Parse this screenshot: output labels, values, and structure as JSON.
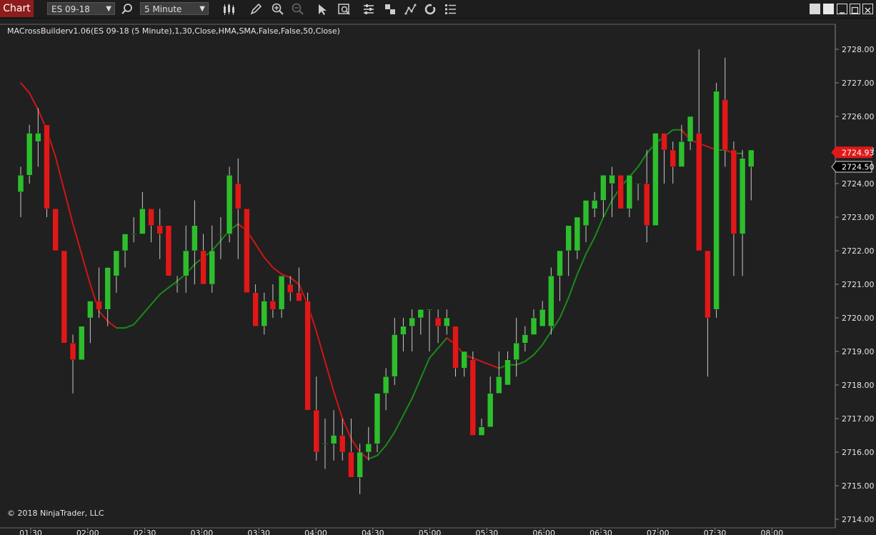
{
  "toolbar": {
    "tab_label": "Chart",
    "instrument": "ES 09-18",
    "interval": "5 Minute",
    "icons": [
      "search-icon",
      "bar-type-icon",
      "draw-icon",
      "zoom-in-icon",
      "zoom-out-icon",
      "pointer-icon",
      "data-box-icon",
      "properties-icon",
      "strategies-icon",
      "indicators-icon",
      "refresh-icon",
      "menu-icon"
    ]
  },
  "chart": {
    "indicator_label": "MACrossBuilderv1.06(ES 09-18 (5 Minute),1,30,Close,HMA,SMA,False,False,50,Close)",
    "copyright": "© 2018 NinjaTrader, LLC"
  },
  "colors": {
    "up": "#2dbe2d",
    "down": "#e01818",
    "ma_up": "#1a8a1a",
    "ma_down": "#d01515",
    "axis_text": "#e6e6e6"
  },
  "chart_data": {
    "type": "candlestick",
    "y_ticks": [
      "2714.00",
      "2715.00",
      "2716.00",
      "2717.00",
      "2718.00",
      "2719.00",
      "2720.00",
      "2721.00",
      "2722.00",
      "2723.00",
      "2724.00",
      "2725.00",
      "2726.00",
      "2727.00",
      "2728.00"
    ],
    "x_ticks": [
      "01:30",
      "02:00",
      "02:30",
      "03:00",
      "03:30",
      "04:00",
      "04:30",
      "05:00",
      "05:30",
      "06:00",
      "06:30",
      "07:00",
      "07:30",
      "08:00"
    ],
    "ylim": [
      2714,
      2728.7
    ],
    "price_markers": [
      {
        "value": 2724.93,
        "label": "2724.93",
        "style": "down"
      },
      {
        "value": 2724.5,
        "label": "2724.50",
        "style": "neutral"
      }
    ],
    "candles_ohlc": [
      [
        2723.75,
        2724.5,
        2723.0,
        2724.25
      ],
      [
        2724.25,
        2725.75,
        2724.0,
        2725.5
      ],
      [
        2725.25,
        2726.25,
        2724.5,
        2725.5
      ],
      [
        2725.75,
        2725.75,
        2723.0,
        2723.25
      ],
      [
        2723.25,
        2723.25,
        2722.0,
        2722.0
      ],
      [
        2722.0,
        2722.0,
        2719.25,
        2719.25
      ],
      [
        2719.25,
        2719.5,
        2717.75,
        2718.75
      ],
      [
        2718.75,
        2719.75,
        2718.75,
        2719.75
      ],
      [
        2720.0,
        2720.5,
        2719.25,
        2720.5
      ],
      [
        2720.5,
        2721.5,
        2720.0,
        2720.25
      ],
      [
        2720.25,
        2721.5,
        2719.75,
        2721.5
      ],
      [
        2721.25,
        2722.0,
        2720.75,
        2722.0
      ],
      [
        2722.0,
        2722.5,
        2721.5,
        2722.5
      ],
      [
        2722.5,
        2723.0,
        2722.25,
        2722.5
      ],
      [
        2722.5,
        2723.75,
        2722.5,
        2723.25
      ],
      [
        2723.25,
        2723.25,
        2722.25,
        2722.75
      ],
      [
        2722.75,
        2723.25,
        2721.75,
        2722.5
      ],
      [
        2722.75,
        2722.75,
        2721.25,
        2721.25
      ],
      [
        2721.0,
        2721.25,
        2720.75,
        2721.0
      ],
      [
        2721.25,
        2722.75,
        2720.75,
        2722.0
      ],
      [
        2722.0,
        2723.5,
        2721.0,
        2722.75
      ],
      [
        2722.0,
        2722.5,
        2721.25,
        2721.0
      ],
      [
        2721.0,
        2722.75,
        2720.75,
        2722.0
      ],
      [
        2722.5,
        2723.0,
        2721.75,
        2722.5
      ],
      [
        2722.5,
        2724.5,
        2722.25,
        2724.25
      ],
      [
        2724.0,
        2724.75,
        2721.75,
        2723.25
      ],
      [
        2723.25,
        2723.25,
        2720.75,
        2720.75
      ],
      [
        2720.75,
        2721.0,
        2719.75,
        2719.75
      ],
      [
        2719.75,
        2720.75,
        2719.5,
        2720.5
      ],
      [
        2720.5,
        2721.0,
        2720.0,
        2720.25
      ],
      [
        2720.25,
        2721.25,
        2720.0,
        2721.25
      ],
      [
        2721.0,
        2721.25,
        2720.5,
        2720.75
      ],
      [
        2720.75,
        2721.5,
        2720.5,
        2720.5
      ],
      [
        2720.5,
        2720.75,
        2717.25,
        2717.25
      ],
      [
        2717.25,
        2718.25,
        2715.75,
        2716.0
      ],
      [
        2716.25,
        2717.0,
        2715.5,
        2716.25
      ],
      [
        2716.25,
        2717.25,
        2715.75,
        2716.5
      ],
      [
        2716.5,
        2717.0,
        2715.75,
        2716.0
      ],
      [
        2716.0,
        2717.0,
        2715.25,
        2715.25
      ],
      [
        2715.25,
        2716.25,
        2714.75,
        2716.0
      ],
      [
        2716.0,
        2716.75,
        2715.75,
        2716.25
      ],
      [
        2716.25,
        2717.75,
        2716.0,
        2717.75
      ],
      [
        2717.75,
        2718.5,
        2717.25,
        2718.25
      ],
      [
        2718.25,
        2720.0,
        2718.0,
        2719.5
      ],
      [
        2719.5,
        2720.0,
        2719.0,
        2719.75
      ],
      [
        2719.75,
        2720.25,
        2719.0,
        2720.0
      ],
      [
        2720.0,
        2720.25,
        2719.5,
        2720.25
      ],
      [
        2720.25,
        2720.25,
        2719.0,
        2720.25
      ],
      [
        2720.0,
        2720.25,
        2719.25,
        2719.75
      ],
      [
        2719.75,
        2720.25,
        2719.5,
        2720.0
      ],
      [
        2719.75,
        2719.75,
        2718.25,
        2718.5
      ],
      [
        2718.5,
        2719.0,
        2718.25,
        2719.0
      ],
      [
        2718.75,
        2719.0,
        2716.5,
        2716.5
      ],
      [
        2716.5,
        2717.0,
        2716.5,
        2716.75
      ],
      [
        2716.75,
        2718.25,
        2716.75,
        2717.75
      ],
      [
        2717.75,
        2719.0,
        2717.75,
        2718.25
      ],
      [
        2718.0,
        2719.0,
        2718.0,
        2718.75
      ],
      [
        2718.75,
        2720.0,
        2718.25,
        2719.25
      ],
      [
        2719.25,
        2719.75,
        2719.0,
        2719.5
      ],
      [
        2719.5,
        2720.25,
        2719.5,
        2720.0
      ],
      [
        2719.75,
        2720.5,
        2719.75,
        2720.25
      ],
      [
        2719.75,
        2721.5,
        2719.5,
        2721.25
      ],
      [
        2721.25,
        2722.0,
        2720.5,
        2722.0
      ],
      [
        2722.0,
        2722.5,
        2721.25,
        2722.75
      ],
      [
        2722.0,
        2723.0,
        2721.75,
        2723.0
      ],
      [
        2722.75,
        2723.25,
        2722.25,
        2723.5
      ],
      [
        2723.25,
        2723.75,
        2723.0,
        2723.5
      ],
      [
        2723.5,
        2724.25,
        2723.0,
        2724.25
      ],
      [
        2724.0,
        2724.5,
        2723.0,
        2724.25
      ],
      [
        2724.25,
        2724.25,
        2723.5,
        2723.25
      ],
      [
        2723.25,
        2724.0,
        2723.0,
        2724.25
      ],
      [
        2724.0,
        2724.0,
        2723.5,
        2724.0
      ],
      [
        2724.0,
        2725.0,
        2722.25,
        2722.75
      ],
      [
        2722.75,
        2725.25,
        2722.75,
        2725.5
      ],
      [
        2725.5,
        2725.5,
        2724.0,
        2725.0
      ],
      [
        2725.0,
        2725.25,
        2724.0,
        2724.5
      ],
      [
        2724.5,
        2725.75,
        2724.5,
        2725.25
      ],
      [
        2725.25,
        2726.0,
        2725.0,
        2726.0
      ],
      [
        2725.5,
        2728.0,
        2722.0,
        2722.0
      ],
      [
        2722.0,
        2722.0,
        2718.25,
        2720.0
      ],
      [
        2720.25,
        2727.0,
        2720.0,
        2726.75
      ],
      [
        2726.5,
        2727.75,
        2724.5,
        2725.0
      ],
      [
        2725.0,
        2725.25,
        2721.25,
        2722.5
      ],
      [
        2722.5,
        2725.0,
        2721.25,
        2724.75
      ],
      [
        2724.5,
        2725.0,
        2723.5,
        2725.0
      ]
    ],
    "ma_series": [
      2727.0,
      2726.7,
      2726.2,
      2725.6,
      2724.8,
      2723.8,
      2722.8,
      2721.9,
      2721.0,
      2720.2,
      2719.9,
      2719.7,
      2719.7,
      2719.8,
      2720.1,
      2720.4,
      2720.7,
      2720.9,
      2721.1,
      2721.3,
      2721.6,
      2721.8,
      2722.0,
      2722.3,
      2722.6,
      2722.8,
      2722.6,
      2722.2,
      2721.8,
      2721.5,
      2721.3,
      2721.2,
      2721.0,
      2720.4,
      2719.6,
      2718.7,
      2717.8,
      2717.0,
      2716.4,
      2716.0,
      2715.8,
      2715.9,
      2716.2,
      2716.6,
      2717.1,
      2717.6,
      2718.2,
      2718.8,
      2719.1,
      2719.4,
      2719.2,
      2718.9,
      2718.8,
      2718.7,
      2718.6,
      2718.5,
      2718.6,
      2718.6,
      2718.7,
      2718.9,
      2719.2,
      2719.6,
      2720.0,
      2720.6,
      2721.3,
      2721.9,
      2722.4,
      2723.0,
      2723.5,
      2723.9,
      2724.2,
      2724.5,
      2724.9,
      2725.2,
      2725.4,
      2725.6,
      2725.6,
      2725.3,
      2725.2,
      2725.1,
      2725.0,
      2725.0,
      2724.9,
      2724.9
    ]
  }
}
